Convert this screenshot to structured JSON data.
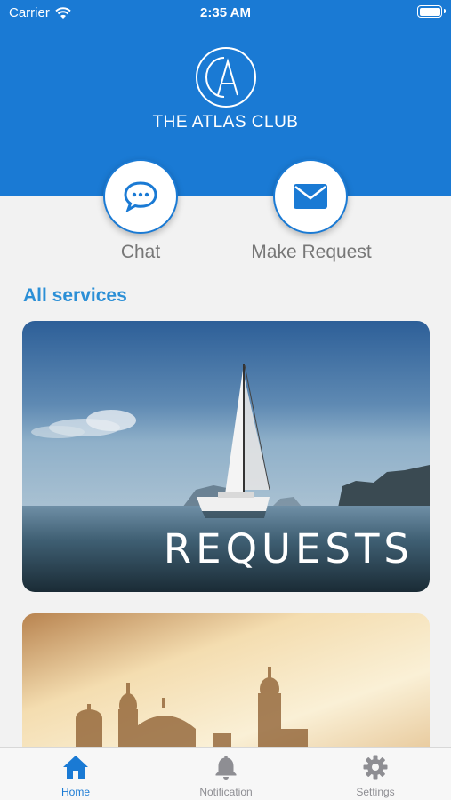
{
  "status_bar": {
    "carrier": "Carrier",
    "time": "2:35 AM"
  },
  "header": {
    "logo_monogram": "CA",
    "club_name": "THE ATLAS CLUB"
  },
  "quick_actions": [
    {
      "label": "Chat",
      "icon": "chat-bubble-icon"
    },
    {
      "label": "Make Request",
      "icon": "envelope-icon"
    }
  ],
  "section_title": "All services",
  "service_cards": [
    {
      "label": "REQUESTS",
      "image": "sailboat-sea"
    },
    {
      "label": "",
      "image": "palace-domes-sunset"
    }
  ],
  "tab_bar": {
    "items": [
      {
        "label": "Home",
        "icon": "home-icon",
        "active": true
      },
      {
        "label": "Notification",
        "icon": "bell-icon",
        "active": false
      },
      {
        "label": "Settings",
        "icon": "gear-icon",
        "active": false
      }
    ]
  },
  "colors": {
    "brand_blue": "#1a7ad4",
    "section_title": "#2b8fd6",
    "inactive_tab": "#8e8e93",
    "background": "#f2f2f2"
  }
}
